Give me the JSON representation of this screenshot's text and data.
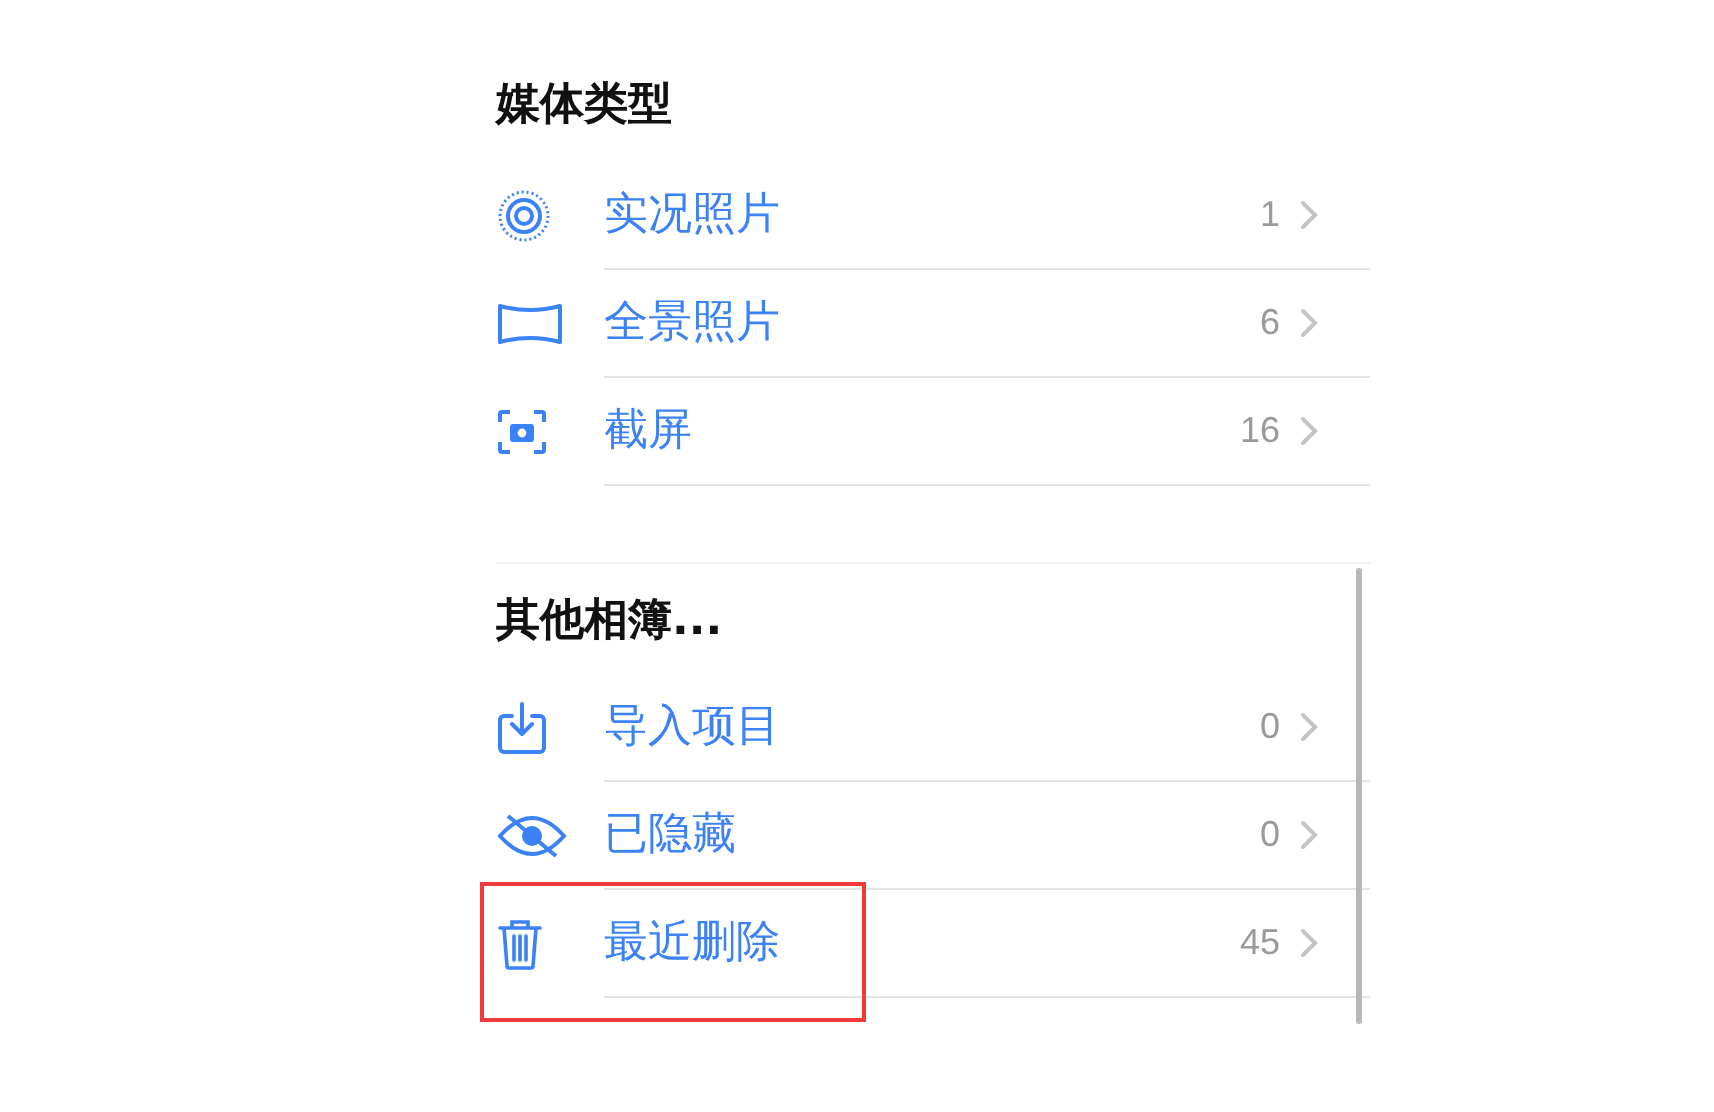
{
  "sections": [
    {
      "title": "媒体类型",
      "items": [
        {
          "label": "实况照片",
          "count": "1",
          "highlighted": false
        },
        {
          "label": "全景照片",
          "count": "6",
          "highlighted": false
        },
        {
          "label": "截屏",
          "count": "16",
          "highlighted": false
        }
      ]
    },
    {
      "title": "其他相簿...",
      "items": [
        {
          "label": "导入项目",
          "count": "0",
          "highlighted": false
        },
        {
          "label": "已隐藏",
          "count": "0",
          "highlighted": false
        },
        {
          "label": "最近删除",
          "count": "45",
          "highlighted": true
        }
      ]
    }
  ]
}
